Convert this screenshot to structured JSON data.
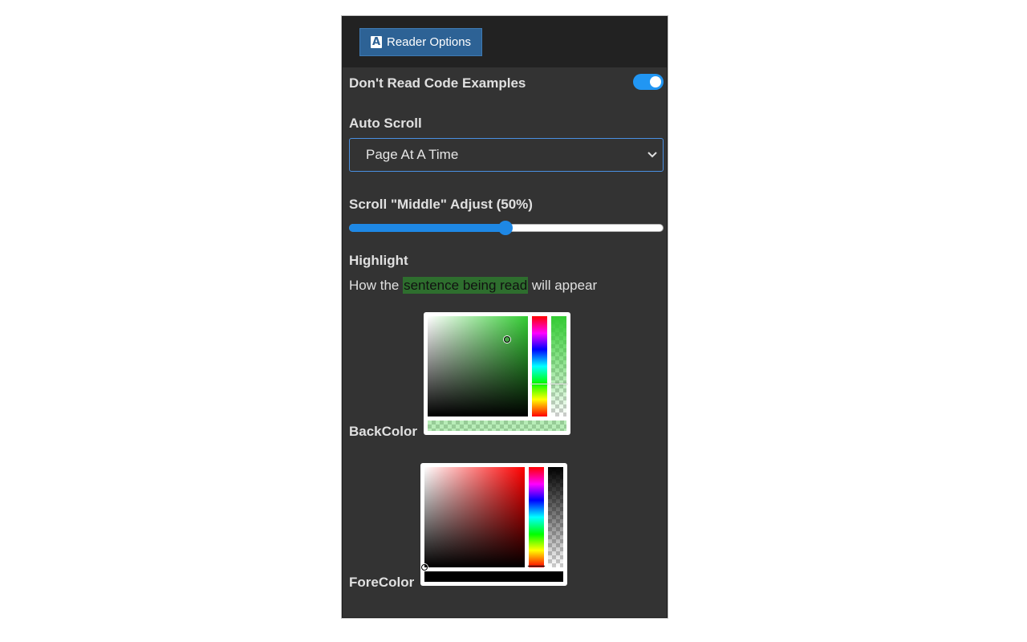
{
  "header": {
    "button_icon": "A",
    "button_label": "Reader Options",
    "icon_name": "text-a-icon"
  },
  "dont_read_code": {
    "label": "Don't Read Code Examples",
    "enabled": true
  },
  "auto_scroll": {
    "label": "Auto Scroll",
    "selected": "Page At A Time"
  },
  "scroll_adjust": {
    "label": "Scroll \"Middle\" Adjust (50%)",
    "value_percent": 50
  },
  "highlight": {
    "label": "Highlight",
    "sample_before": "How the ",
    "sample_highlight": "sentence being read",
    "sample_after": " will appear"
  },
  "backcolor": {
    "label": "BackColor",
    "hue_color": "#33cc33",
    "color": "#2e6e2e",
    "preview_color": "rgba(51,204,51,0.35)",
    "alpha_percent": 32
  },
  "forecolor": {
    "label": "ForeColor",
    "hue_color": "#ff0000",
    "color": "#000000",
    "alpha_percent": 100
  },
  "colors": {
    "accent": "#2196f3",
    "panel_bg": "#333333",
    "header_bg": "#222222",
    "button_bg": "#2d6295"
  }
}
